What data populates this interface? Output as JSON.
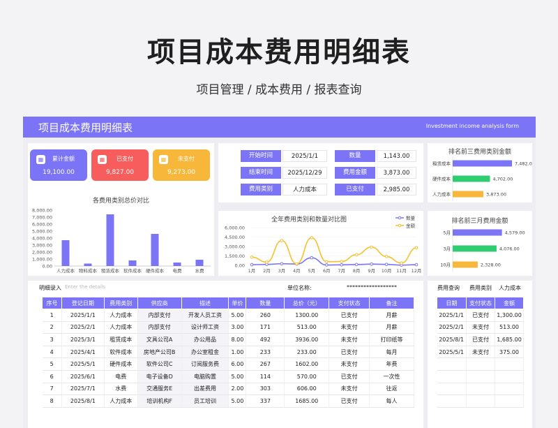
{
  "page": {
    "title": "项目成本费用明细表",
    "subtitle": "项目管理 / 成本费用  / 报表查询"
  },
  "banner": {
    "title": "项目成本费用明细表",
    "subtitle": "Investment income analysis form"
  },
  "colors": {
    "accent": "#7b74f6",
    "red": "#f85d5d",
    "amber": "#f6b73b",
    "green": "#2fcc71"
  },
  "summary_cards": [
    {
      "label": "累计金额",
      "value": "19,100.00",
      "icon": "calculator-icon",
      "color": "#7b74f6"
    },
    {
      "label": "已支付",
      "value": "9,827.00",
      "icon": "calculator-icon",
      "color": "#f85d5d"
    },
    {
      "label": "未支付",
      "value": "9,273.00",
      "icon": "calculator-icon",
      "color": "#f6b73b"
    }
  ],
  "info": {
    "start_label": "开始时间",
    "start_value": "2025/1/1",
    "end_label": "结束时间",
    "end_value": "2025/12/29",
    "category_label": "费用类别",
    "category_value": "人力成本",
    "count_label": "数量",
    "count_value": "1,143.00",
    "amount_label": "费用金额",
    "amount_value": "3,873.00",
    "paid_label": "已支付",
    "paid_value": "2,985.00"
  },
  "entry": {
    "label": "明细录入",
    "placeholder": "Enter the details",
    "unit_label": "单位名称:",
    "unit_value": "******************"
  },
  "table": {
    "headers": [
      "序号",
      "登记日期",
      "费用类别",
      "供应商",
      "描述",
      "单价",
      "数量",
      "总价（元）",
      "支付状态",
      "备注"
    ],
    "rows": [
      [
        "1",
        "2025/1/1",
        "人力成本",
        "内部支付",
        "开发人员工资",
        "5.00",
        "260",
        "1300.00",
        "已支付",
        "月薪"
      ],
      [
        "2",
        "2025/2/1",
        "人力成本",
        "内部支付",
        "设计师工资",
        "3.00",
        "171",
        "513.00",
        "未支付",
        "月薪"
      ],
      [
        "3",
        "2025/3/1",
        "租赁成本",
        "文具公司A",
        "办公用品",
        "8.00",
        "492",
        "3936.00",
        "未支付",
        "打印纸等"
      ],
      [
        "4",
        "2025/4/1",
        "软件成本",
        "房地产公司B",
        "办公室租金",
        "1.00",
        "233",
        "233.00",
        "已支付",
        "每月"
      ],
      [
        "5",
        "2025/5/1",
        "硬件成本",
        "软件公司C",
        "订阅服务费",
        "6.00",
        "267",
        "1602.00",
        "未支付",
        "年费"
      ],
      [
        "6",
        "2025/6/1",
        "电费",
        "电子设备D",
        "电脑购置",
        "5.00",
        "114",
        "570.00",
        "已支付",
        "一次性"
      ],
      [
        "7",
        "2025/7/1",
        "水费",
        "交通服务E",
        "出差费用",
        "2.00",
        "303",
        "606.00",
        "未支付",
        "往返"
      ],
      [
        "8",
        "2025/8/1",
        "人力成本",
        "培训机构F",
        "员工培训",
        "5.00",
        "337",
        "1685.00",
        "已支付",
        "每人"
      ]
    ]
  },
  "query": {
    "label1": "费用查询",
    "label2": "费用类别",
    "label3": "人力成本",
    "headers": [
      "日期",
      "支付状态",
      "金额"
    ],
    "rows": [
      [
        "2025/1/1",
        "已支付",
        "1,300.00"
      ],
      [
        "2025/2/1",
        "未支付",
        "513.00"
      ],
      [
        "2025/8/1",
        "已支付",
        "1,685.00"
      ],
      [
        "2025/5/1",
        "未支付",
        "375.00"
      ]
    ]
  },
  "chart_data": [
    {
      "type": "bar",
      "title": "各费用类别总价对比",
      "categories": [
        "人力成本",
        "物料成本",
        "租赁成本",
        "软件成本",
        "硬件成本",
        "电费",
        "水费"
      ],
      "values": [
        3700,
        350,
        7400,
        800,
        4600,
        500,
        900
      ],
      "ylim": [
        0,
        8000
      ],
      "yticks": [
        "0.00",
        "1,000.00",
        "2,000.00",
        "3,000.00",
        "4,000.00",
        "5,000.00",
        "6,000.00",
        "7,000.00",
        "8,000.00"
      ],
      "color": "#7b74f6"
    },
    {
      "type": "line",
      "title": "全年费用类别和数量对比图",
      "categories": [
        "1月",
        "2月",
        "3月",
        "4月",
        "5月",
        "6月",
        "7月",
        "8月",
        "9月",
        "10月",
        "11月",
        "12月"
      ],
      "series": [
        {
          "name": "数量",
          "color": "#7b74f6",
          "values": [
            100,
            150,
            250,
            200,
            1200,
            50,
            80,
            130,
            200,
            150,
            40,
            100
          ]
        },
        {
          "name": "金额",
          "color": "#f6c12c",
          "values": [
            1300,
            513,
            3936,
            233,
            4400,
            570,
            606,
            1685,
            2900,
            1400,
            360,
            2800
          ]
        }
      ],
      "ylim": [
        0,
        6000
      ],
      "yticks": [
        "0.00",
        "1,500.00",
        "3,000.00",
        "4,500.00",
        "6,000.00"
      ],
      "legend": "top-right"
    },
    {
      "type": "bar",
      "orientation": "horizontal",
      "title": "排名前三费用类别金额",
      "categories": [
        "租赁成本",
        "硬件成本",
        "人力成本"
      ],
      "values": [
        7482.0,
        4702.0,
        3873.0
      ],
      "labels": [
        "7,482.00",
        "4,702.00",
        "3,873.00"
      ],
      "colors": [
        "#7b74f6",
        "#2fcc71",
        "#f6b73b"
      ],
      "xlim": [
        0,
        9500
      ]
    },
    {
      "type": "bar",
      "orientation": "horizontal",
      "title": "排名前三月费用金额",
      "categories": [
        "5月",
        "3月",
        "10月"
      ],
      "values": [
        4579.0,
        4076.0,
        2328.0
      ],
      "labels": [
        "4,579.00",
        "4,076.00",
        "2,328.00"
      ],
      "colors": [
        "#7b74f6",
        "#2fcc71",
        "#f6b73b"
      ],
      "xlim": [
        0,
        7000
      ]
    }
  ]
}
